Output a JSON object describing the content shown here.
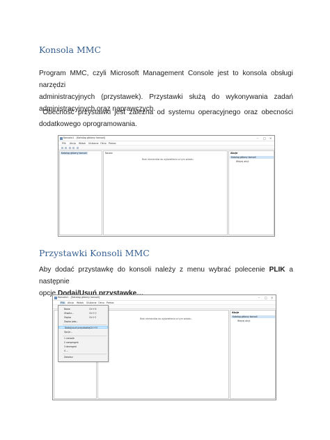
{
  "section1": {
    "heading": "Konsola MMC",
    "para1_lines": [
      "Program MMC, czyli Microsoft Management Console jest to konsola obsługi narzędzi",
      "administracyjnych (przystawek). Przystawki służą do wykonywania zadań",
      "administracyjnych oraz naprawczych."
    ],
    "para2_lines": [
      " Obecność przystawki jest zależna od systemu operacyjnego oraz obecności",
      "dodatkowego oprogramowania."
    ]
  },
  "screenshot1": {
    "title": "Konsola1 - [Katalog główny konsoli]",
    "menu": [
      "Plik",
      "Akcja",
      "Widok",
      "Ulubione",
      "Okno",
      "Pomoc"
    ],
    "tree_item": "Katalog główny konsoli",
    "center_header": "Nazwa",
    "center_message": "Brak elementów do wyświetlenia w tym widoku.",
    "actions_header": "Akcje",
    "actions_selected": "Katalog główny konsoli",
    "actions_item": "Więcej akcji"
  },
  "section2": {
    "heading": "Przystawki Konsoli MMC",
    "para_line1_pre": "Aby dodać przystawkę do konsoli należy z menu wybrać polecenie ",
    "para_line1_bold": "PLIK",
    "para_line1_post": " a następnie",
    "para_line2_pre": "opcję ",
    "para_line2_bold": "Dodaj/Usuń przystawkę…"
  },
  "screenshot2": {
    "title": "Konsola1 - [Katalog główny konsoli]",
    "menu": [
      "Plik",
      "Akcja",
      "Widok",
      "Ulubione",
      "Okno",
      "Pomoc"
    ],
    "center_message": "Brak elementów do wyświetlenia w tym widoku.",
    "actions_header": "Akcje",
    "actions_selected": "Katalog główny konsoli",
    "actions_item": "Więcej akcji",
    "file_menu": [
      {
        "label": "Nowa",
        "shortcut": "Ctrl+N"
      },
      {
        "label": "Otwórz...",
        "shortcut": "Ctrl+O"
      },
      {
        "label": "Zapisz",
        "shortcut": "Ctrl+S"
      },
      {
        "label": "Zapisz jako...",
        "shortcut": ""
      },
      {
        "label": "Dodaj/usuń przystawkę...",
        "shortcut": "Ctrl+M"
      },
      {
        "label": "Opcje...",
        "shortcut": ""
      },
      {
        "label": "1 console",
        "shortcut": ""
      },
      {
        "label": "2 compmgmt",
        "shortcut": ""
      },
      {
        "label": "3 devmgmt",
        "shortcut": ""
      },
      {
        "label": "4 ...",
        "shortcut": ""
      },
      {
        "label": "Zakończ",
        "shortcut": ""
      }
    ]
  },
  "colors": {
    "heading": "#365f91",
    "selection": "#cfe3f6"
  }
}
